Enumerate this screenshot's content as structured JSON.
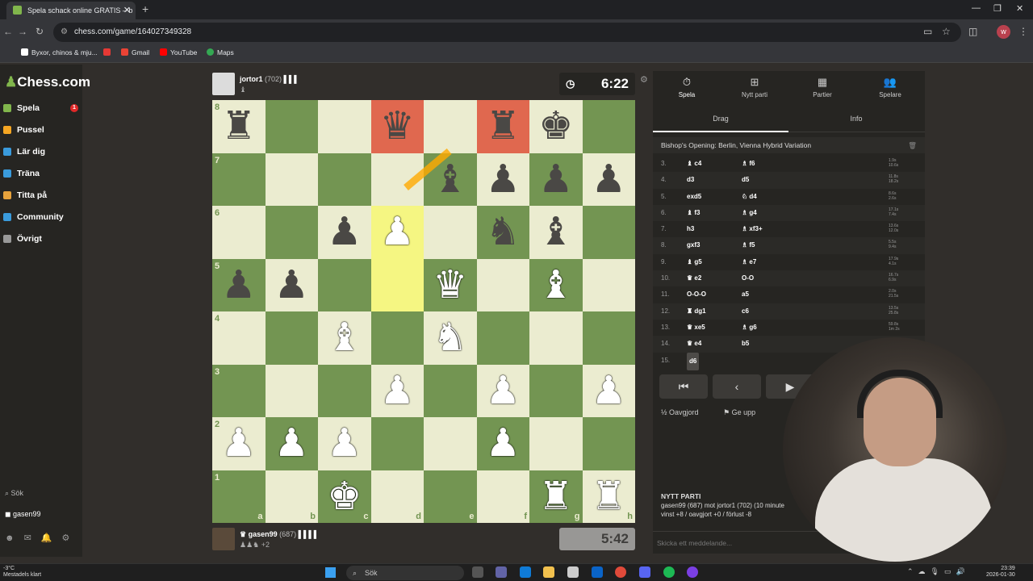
{
  "browser": {
    "tab_title": "Spela schack online GRATIS – b",
    "url": "chess.com/game/164027349328",
    "bookmarks": [
      "Byxor, chinos & mju...",
      "Gmail",
      "YouTube",
      "Maps"
    ],
    "profile_initial": "w"
  },
  "sidebar": {
    "logo_prefix": "♟",
    "logo": "Chess.com",
    "items": [
      {
        "label": "Spela",
        "color": "#81b64c"
      },
      {
        "label": "Pussel",
        "color": "#f5a623"
      },
      {
        "label": "Lär dig",
        "color": "#3a9bdc"
      },
      {
        "label": "Träna",
        "color": "#3a9bdc"
      },
      {
        "label": "Titta på",
        "color": "#e8a33c"
      },
      {
        "label": "Community",
        "color": "#3a9bdc"
      },
      {
        "label": "Övrigt",
        "color": "#999999"
      }
    ],
    "badge": "1",
    "search": "Sök",
    "user": "gasen99"
  },
  "top_player": {
    "name": "jortor1",
    "rating": "(702)",
    "clock": "6:22"
  },
  "bottom_player": {
    "name": "gasen99",
    "rating": "(687)",
    "captured_extra": "+2",
    "clock": "5:42"
  },
  "board": {
    "ranks": [
      "8",
      "7",
      "6",
      "5",
      "4",
      "3",
      "2",
      "1"
    ],
    "files": [
      "a",
      "b",
      "c",
      "d",
      "e",
      "f",
      "g",
      "h"
    ],
    "rows": [
      [
        "br",
        "",
        "",
        "bq",
        "",
        "br",
        "bk",
        ""
      ],
      [
        "",
        "",
        "",
        "",
        "bb",
        "bp",
        "bp",
        "bp"
      ],
      [
        "",
        "",
        "bp",
        "wp",
        "",
        "bn",
        "bb",
        ""
      ],
      [
        "bp",
        "bp",
        "",
        "",
        "wq",
        "",
        "wb",
        ""
      ],
      [
        "",
        "",
        "wb",
        "",
        "wn",
        "",
        "",
        ""
      ],
      [
        "",
        "",
        "",
        "wp",
        "",
        "wp",
        "",
        "wp"
      ],
      [
        "wp",
        "wp",
        "wp",
        "",
        "",
        "wp",
        "",
        ""
      ],
      [
        "",
        "",
        "wk",
        "",
        "",
        "",
        "wr",
        "wr"
      ]
    ]
  },
  "panel": {
    "tabs": [
      "Spela",
      "Nytt parti",
      "Partier",
      "Spelare"
    ],
    "subtabs": [
      "Drag",
      "Info"
    ],
    "opening": "Bishop's Opening: Berlin, Vienna Hybrid Variation",
    "moves": [
      {
        "n": "3.",
        "w": "♝ c4",
        "b": "♗ f6",
        "t1": "1.9s",
        "t2": "10.6s"
      },
      {
        "n": "4.",
        "w": "d3",
        "b": "d5",
        "t1": "11.8s",
        "t2": "18.2s"
      },
      {
        "n": "5.",
        "w": "exd5",
        "b": "♘ d4",
        "t1": "8.6s",
        "t2": "2.6s"
      },
      {
        "n": "6.",
        "w": "♝ f3",
        "b": "♗ g4",
        "t1": "17.1s",
        "t2": "7.4s"
      },
      {
        "n": "7.",
        "w": "h3",
        "b": "♗ xf3+",
        "t1": "13.6s",
        "t2": "12.0s"
      },
      {
        "n": "8.",
        "w": "gxf3",
        "b": "♗ f5",
        "t1": "5.5s",
        "t2": "9.4s"
      },
      {
        "n": "9.",
        "w": "♝ g5",
        "b": "♗ e7",
        "t1": "17.9s",
        "t2": "4.1s"
      },
      {
        "n": "10.",
        "w": "♛ e2",
        "b": "O-O",
        "t1": "16.7s",
        "t2": "6.9s"
      },
      {
        "n": "11.",
        "w": "O-O-O",
        "b": "a5",
        "t1": "2.0s",
        "t2": "21.5s"
      },
      {
        "n": "12.",
        "w": "♜ dg1",
        "b": "c6",
        "t1": "13.5s",
        "t2": "25.8s"
      },
      {
        "n": "13.",
        "w": "♛ xe5",
        "b": "♗ g6",
        "t1": "59.8s",
        "t2": "1m 2s"
      },
      {
        "n": "14.",
        "w": "♛ e4",
        "b": "b5",
        "t1": "",
        "t2": ""
      },
      {
        "n": "15.",
        "w": "d6",
        "b": "",
        "t1": "",
        "t2": ""
      }
    ],
    "draw": "Oavgjord",
    "resign": "Ge upp",
    "new_game_title": "NYTT PARTI",
    "new_game_line1": "gasen99 (687) mot jortor1 (702) (10 minute",
    "new_game_line2": "vinst +8 / oavgjort +0 / förlust -8",
    "message_placeholder": "Skicka ett meddelande..."
  },
  "taskbar": {
    "weather_temp": "-3°C",
    "weather_text": "Mestadels klart",
    "search": "Sök",
    "time": "23:39",
    "date": "2026-01-30"
  },
  "colors": {
    "light_square": "#ebecd0",
    "dark_square": "#739552",
    "highlight_red": "#e0684f",
    "highlight_yellow": "#f5f682"
  }
}
